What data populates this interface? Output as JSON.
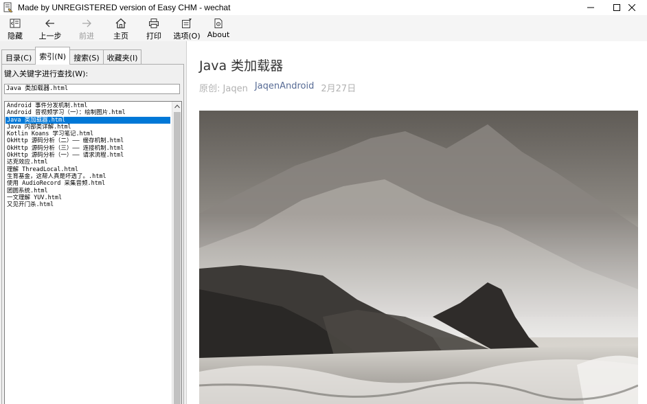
{
  "window": {
    "title": "Made by UNREGISTERED version of Easy CHM - wechat",
    "controls": [
      "minimize",
      "maximize",
      "close"
    ]
  },
  "toolbar": {
    "buttons": [
      {
        "label": "隐藏",
        "icon": "hide-icon",
        "enabled": true
      },
      {
        "label": "上一步",
        "icon": "back-arrow-icon",
        "enabled": true
      },
      {
        "label": "前进",
        "icon": "forward-arrow-icon",
        "enabled": false
      },
      {
        "label": "主页",
        "icon": "home-icon",
        "enabled": true
      },
      {
        "label": "打印",
        "icon": "printer-icon",
        "enabled": true
      },
      {
        "label": "选项(O)",
        "icon": "options-icon",
        "enabled": true
      },
      {
        "label": "About",
        "icon": "about-icon",
        "enabled": true
      }
    ]
  },
  "sidebar": {
    "tabs": [
      {
        "label": "目录(C)",
        "active": false
      },
      {
        "label": "索引(N)",
        "active": true
      },
      {
        "label": "搜索(S)",
        "active": false
      },
      {
        "label": "收藏夹(I)",
        "active": false
      }
    ],
    "keyword_label": "键入关键字进行查找(W):",
    "keyword_value": "Java 类加载器.html",
    "index_items": [
      "Android 事件分发机制.html",
      "Android 音视频学习（一）：绘制图片.html",
      "Java 类加载器.html",
      "Java 内部类详解.html",
      "Kotlin Koans 学习笔记.html",
      "OkHttp 源码分析（二）—— 缓存机制.html",
      "OkHttp 源码分析（三）—— 连接机制.html",
      "OkHttp 源码分析（一）—— 请求流程.html",
      "达克效应.html",
      "理解 ThreadLocal.html",
      "生育基金，这帮人真是坏透了。.html",
      "使用 AudioRecord 采集音频.html",
      "团圆系统.html",
      "一文理解 YUV.html",
      "又见开门杀.html"
    ],
    "selected_index": 2
  },
  "article": {
    "title": "Java 类加载器",
    "original_label": "原创:",
    "author": "Jaqen",
    "account": "JaqenAndroid",
    "date": "2月27日",
    "image_description": "black-and-white misty coastal mountains with crashing waves"
  },
  "colors": {
    "selection": "#0078d7",
    "account_link": "#576b95",
    "meta_gray": "#b2b2b2",
    "toolbar_bg": "#f5f5f5",
    "pane_bg": "#f0f0f0"
  }
}
